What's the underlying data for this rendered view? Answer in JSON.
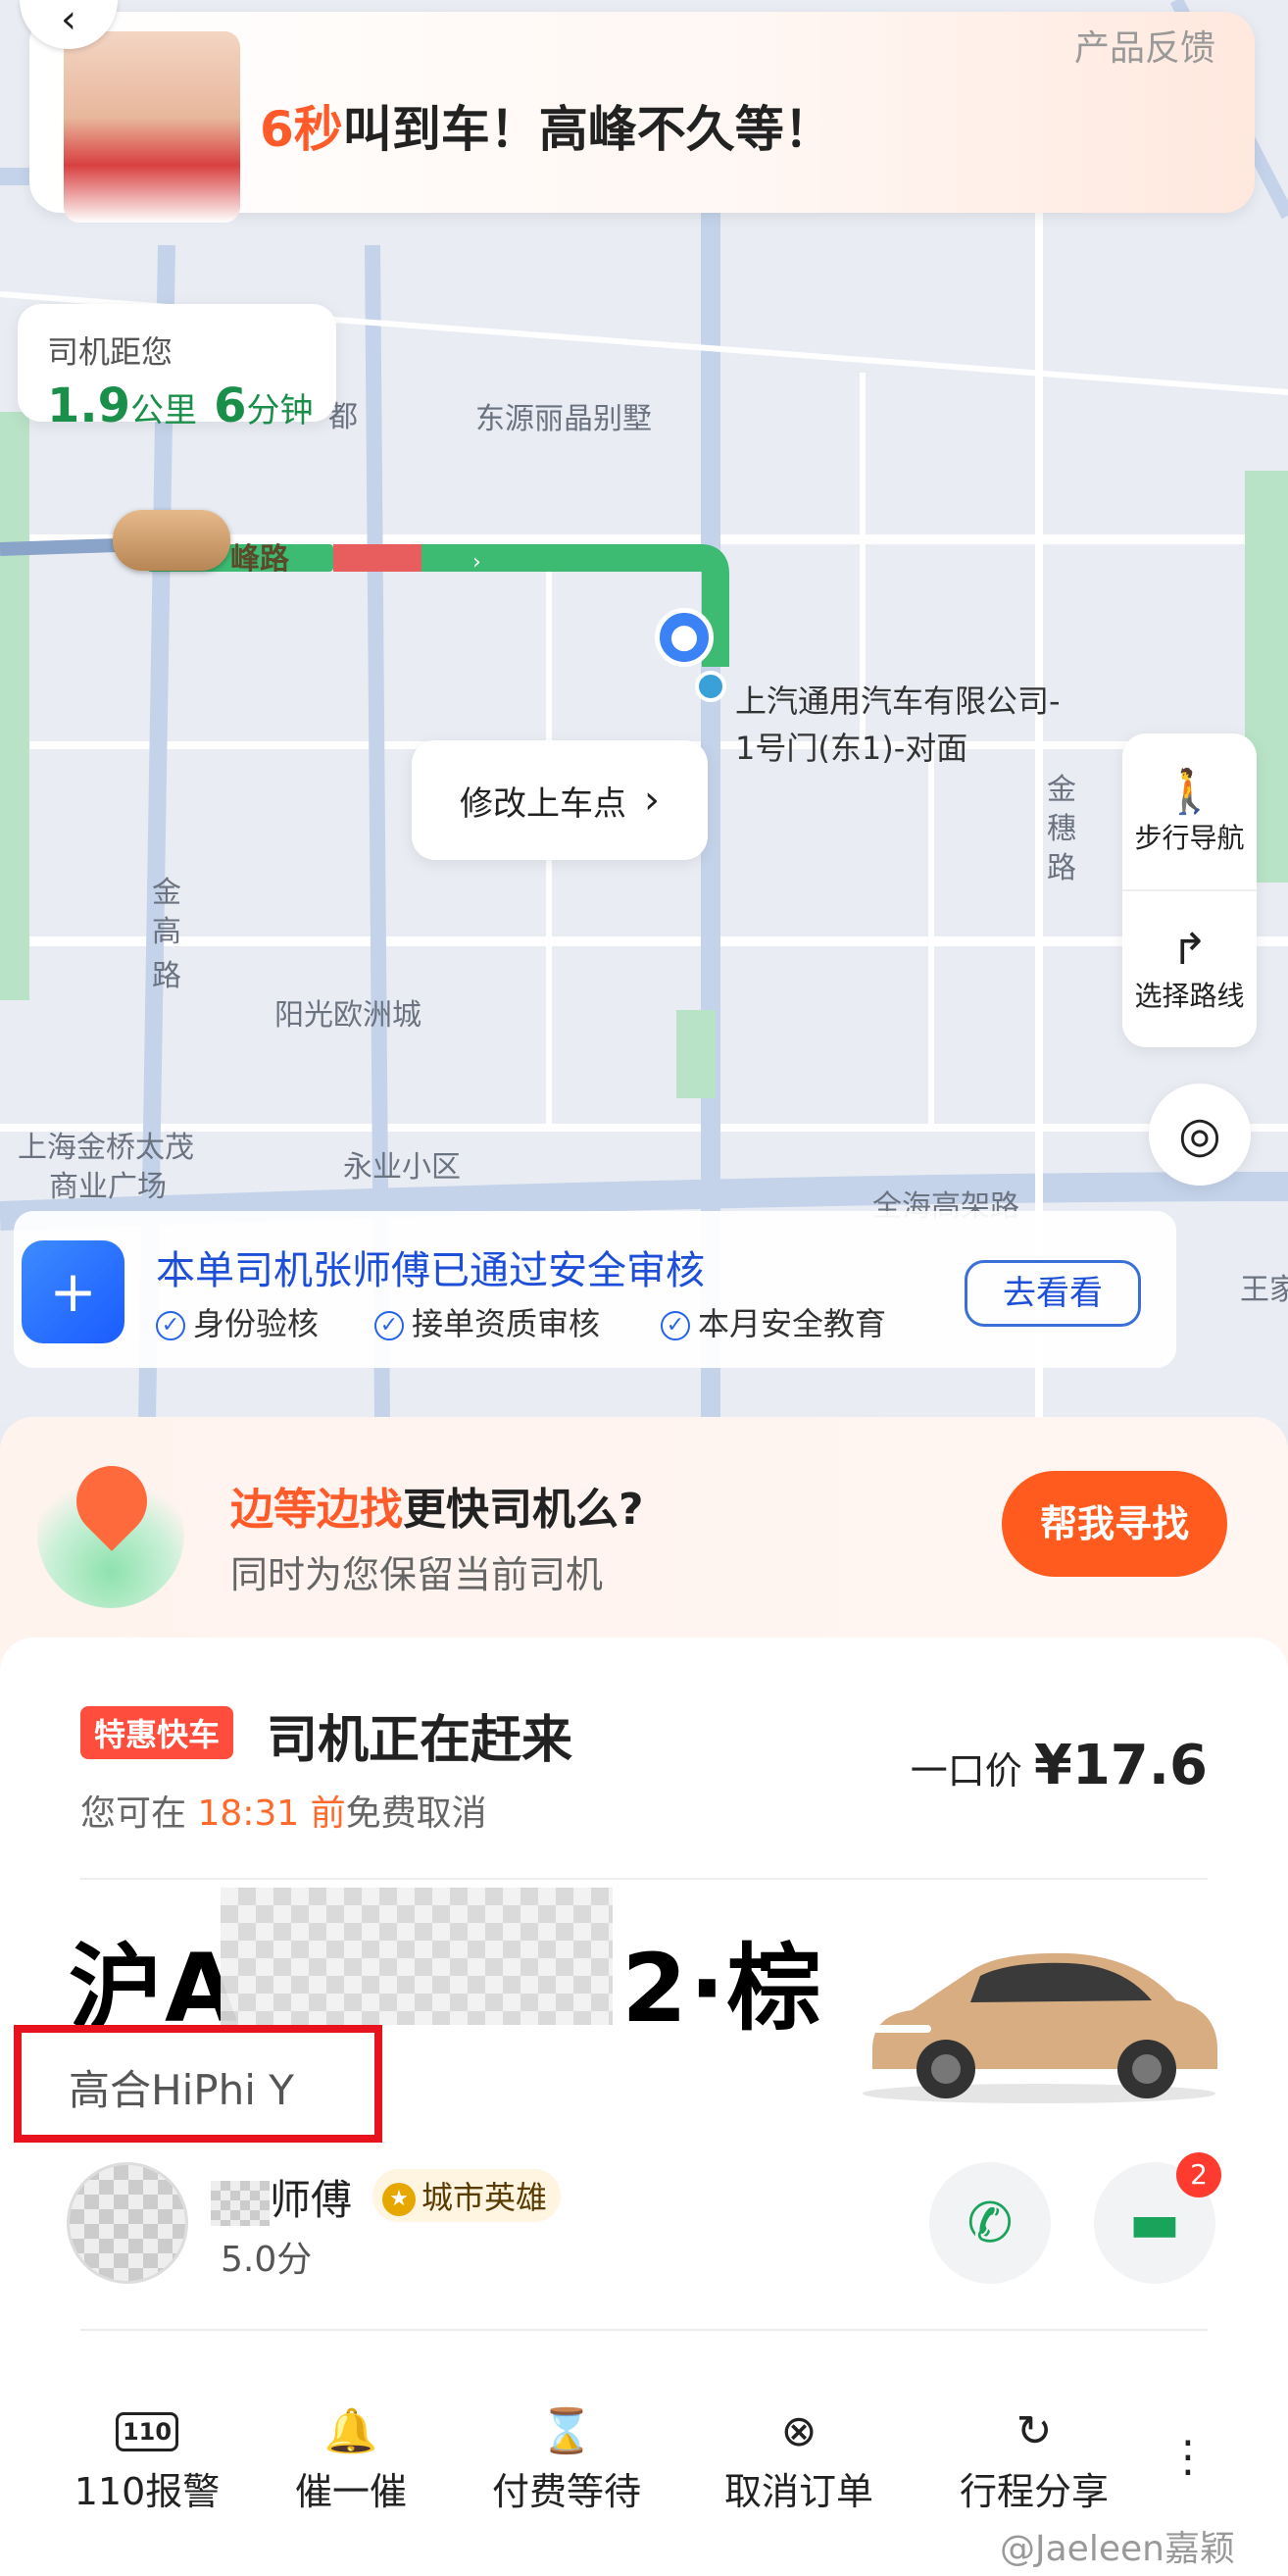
{
  "promo": {
    "highlight": "6秒",
    "text": "叫到车！高峰不久等！",
    "feedback": "产品反馈"
  },
  "distance": {
    "title": "司机距您",
    "km": "1.9",
    "km_unit": "公里",
    "min": "6",
    "min_unit": "分钟"
  },
  "map": {
    "labels": [
      "东源丽晶别墅",
      "阳光欧洲城",
      "上海金桥太茂",
      "商业广场",
      "永业小区",
      "金",
      "高",
      "路",
      "金",
      "穗",
      "路",
      "全海高架路",
      "王家",
      "峰路",
      "都"
    ],
    "pickup_label_1": "上汽通用汽车有限公司-",
    "pickup_label_2": "1号门(东1)-对面"
  },
  "modify_pickup": {
    "label": "修改上车点"
  },
  "side_buttons": [
    {
      "label": "步行导航"
    },
    {
      "label": "选择路线"
    }
  ],
  "safety": {
    "title": "本单司机张师傅已通过安全审核",
    "checks": [
      "身份验核",
      "接单资质审核",
      "本月安全教育"
    ],
    "button": "去看看"
  },
  "find": {
    "highlight": "边等边找",
    "title_rest": "更快司机么?",
    "subtitle": "同时为您保留当前司机",
    "button": "帮我寻找"
  },
  "order": {
    "tag": "特惠快车",
    "status": "司机正在赶来",
    "cancel_prefix": "您可在 ",
    "cancel_time": "18:31 前",
    "cancel_suffix": "免费取消",
    "price_label": "一口价",
    "price": "¥17.6"
  },
  "vehicle": {
    "plate_prefix": "沪A",
    "plate_suffix": "2·棕",
    "model": "高合HiPhi Y"
  },
  "driver": {
    "name": "师傅",
    "title": "城市英雄",
    "score": "5.0分",
    "message_count": "2"
  },
  "actions": [
    {
      "icon": "110",
      "label": "110报警"
    },
    {
      "icon": "🔔",
      "label": "催一催"
    },
    {
      "icon": "⌛",
      "label": "付费等待"
    },
    {
      "icon": "⊗",
      "label": "取消订单"
    },
    {
      "icon": "↻",
      "label": "行程分享"
    }
  ],
  "watermark": "@Jaeleen嘉颖",
  "colors": {
    "accent": "#ff5a2a",
    "route": "#3dbb73",
    "congestion": "#e85d5d",
    "primary_blue": "#1d4ed8"
  }
}
